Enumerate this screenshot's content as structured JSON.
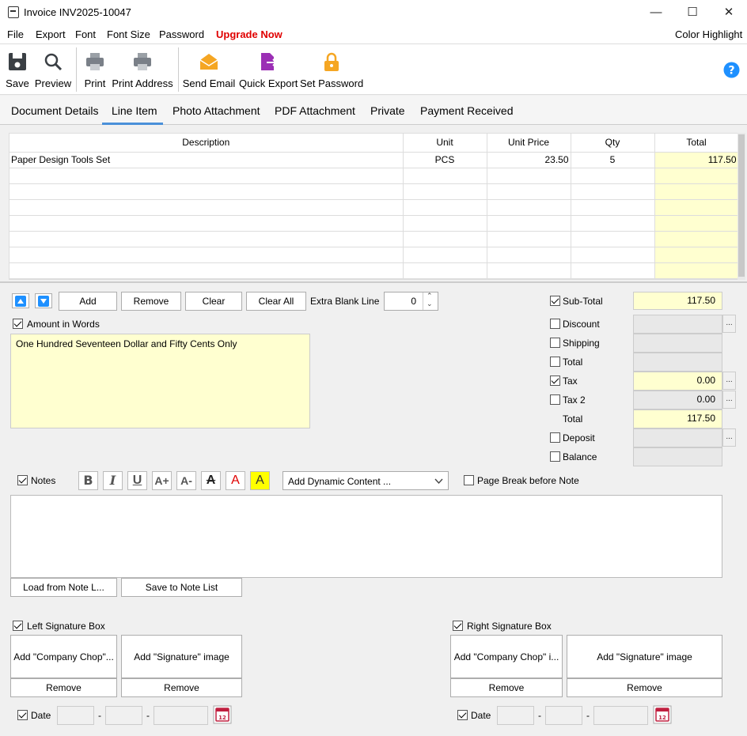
{
  "window": {
    "title": "Invoice INV2025-10047"
  },
  "menu": {
    "items": [
      "File",
      "Export",
      "Font",
      "Font Size",
      "Password"
    ],
    "upgrade": "Upgrade Now",
    "color_highlight": "Color Highlight"
  },
  "toolbar": {
    "save": "Save",
    "preview": "Preview",
    "print": "Print",
    "print_address": "Print Address",
    "send_email": "Send Email",
    "quick_export": "Quick Export",
    "set_password": "Set Password"
  },
  "tabs": [
    "Document Details",
    "Line Item",
    "Photo Attachment",
    "PDF Attachment",
    "Private",
    "Payment Received"
  ],
  "grid": {
    "headers": [
      "Description",
      "Unit",
      "Unit Price",
      "Qty",
      "Total"
    ],
    "rows": [
      {
        "description": "Paper Design Tools Set",
        "unit": "PCS",
        "unit_price": "23.50",
        "qty": "5",
        "total": "117.50"
      }
    ]
  },
  "controls": {
    "add": "Add",
    "remove": "Remove",
    "clear": "Clear",
    "clear_all": "Clear All",
    "extra_blank_line": "Extra Blank Line",
    "extra_blank_value": "0"
  },
  "words": {
    "label": "Amount in Words",
    "text": "One Hundred Seventeen Dollar and Fifty Cents Only"
  },
  "totals": {
    "subtotal_label": "Sub-Total",
    "subtotal": "117.50",
    "discount_label": "Discount",
    "shipping_label": "Shipping",
    "total1_label": "Total",
    "tax_label": "Tax",
    "tax": "0.00",
    "tax2_label": "Tax 2",
    "tax2": "0.00",
    "total_label": "Total",
    "total": "117.50",
    "deposit_label": "Deposit",
    "balance_label": "Balance",
    "ellipsis": "..."
  },
  "notes": {
    "label": "Notes",
    "dynamic": "Add Dynamic Content ...",
    "page_break": "Page Break before Note",
    "load": "Load from Note L...",
    "save": "Save to Note List"
  },
  "signature": {
    "left_label": "Left Signature Box",
    "right_label": "Right Signature Box",
    "left_chop": "Add \"Company Chop\"...",
    "right_chop": "Add \"Company Chop\" i...",
    "sig_image": "Add \"Signature\" image",
    "remove": "Remove",
    "date": "Date",
    "dash": "-"
  },
  "colors": {
    "accent": "#4a90d9",
    "yellow": "#ffffd0",
    "upgrade": "#e00000"
  }
}
